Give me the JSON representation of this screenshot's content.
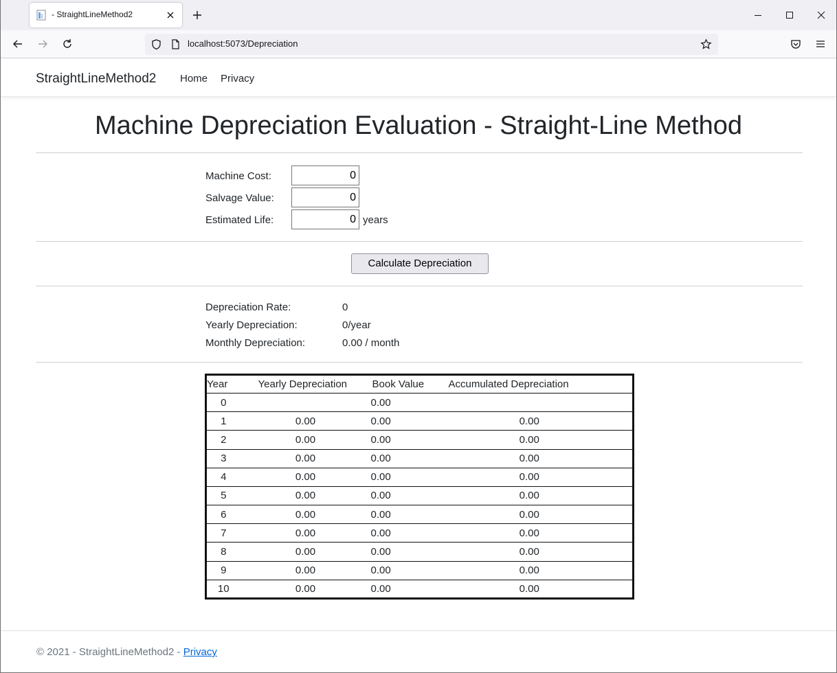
{
  "browser": {
    "tab_title": "- StraightLineMethod2",
    "url": "localhost:5073/Depreciation"
  },
  "site": {
    "brand": "StraightLineMethod2",
    "nav": [
      {
        "label": "Home"
      },
      {
        "label": "Privacy"
      }
    ]
  },
  "page": {
    "title": "Machine Depreciation Evaluation - Straight-Line Method"
  },
  "form": {
    "machine_cost_label": "Machine Cost:",
    "machine_cost_value": "0",
    "salvage_value_label": "Salvage Value:",
    "salvage_value_value": "0",
    "estimated_life_label": "Estimated Life:",
    "estimated_life_value": "0",
    "estimated_life_suffix": "years",
    "calculate_label": "Calculate Depreciation"
  },
  "results": {
    "rate_label": "Depreciation Rate:",
    "rate_value": "0",
    "yearly_label": "Yearly Depreciation:",
    "yearly_value": "0/year",
    "monthly_label": "Monthly Depreciation:",
    "monthly_value": "0.00 / month"
  },
  "table": {
    "headers": [
      "Year",
      "Yearly Depreciation",
      "Book Value",
      "Accumulated Depreciation"
    ],
    "rows": [
      [
        "0",
        "",
        "0.00",
        ""
      ],
      [
        "1",
        "0.00",
        "0.00",
        "0.00"
      ],
      [
        "2",
        "0.00",
        "0.00",
        "0.00"
      ],
      [
        "3",
        "0.00",
        "0.00",
        "0.00"
      ],
      [
        "4",
        "0.00",
        "0.00",
        "0.00"
      ],
      [
        "5",
        "0.00",
        "0.00",
        "0.00"
      ],
      [
        "6",
        "0.00",
        "0.00",
        "0.00"
      ],
      [
        "7",
        "0.00",
        "0.00",
        "0.00"
      ],
      [
        "8",
        "0.00",
        "0.00",
        "0.00"
      ],
      [
        "9",
        "0.00",
        "0.00",
        "0.00"
      ],
      [
        "10",
        "0.00",
        "0.00",
        "0.00"
      ]
    ]
  },
  "footer": {
    "text": "© 2021 - StraightLineMethod2 - ",
    "link": "Privacy"
  }
}
